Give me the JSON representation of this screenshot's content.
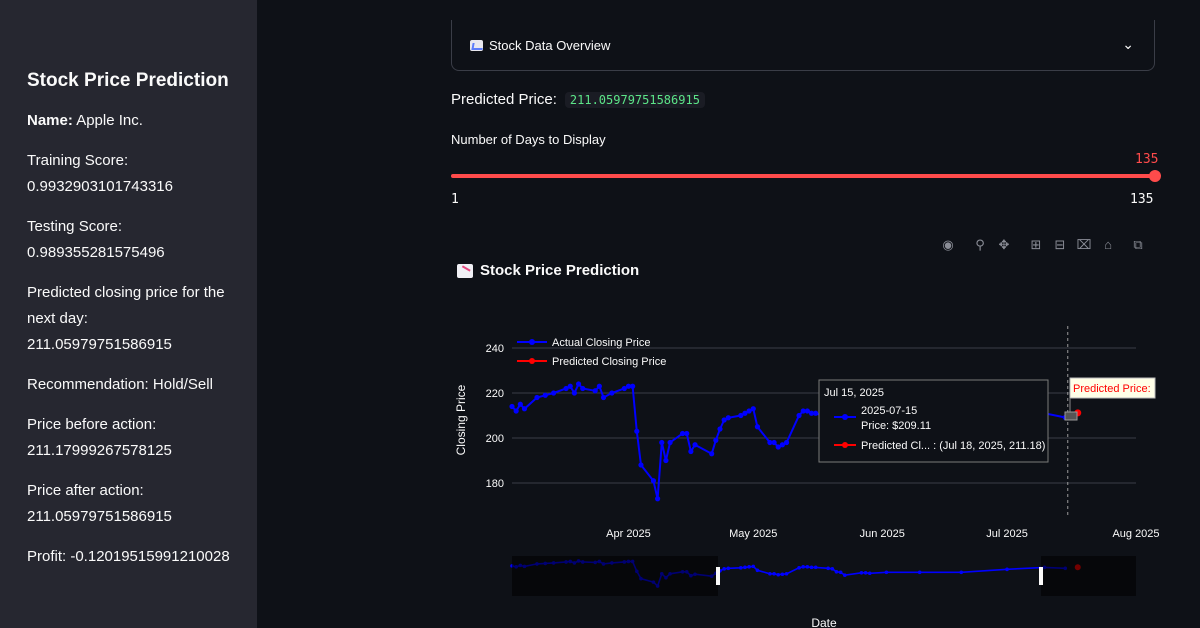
{
  "sidebar": {
    "title": "Stock Price Prediction",
    "name_label": "Name:",
    "name_value": "Apple Inc.",
    "training_label": "Training Score:",
    "training_value": "0.9932903101743316",
    "testing_label": "Testing Score:",
    "testing_value": "0.989355281575496",
    "predicted_label": "Predicted closing price for the next day:",
    "predicted_value": "211.05979751586915",
    "recommendation": "Recommendation: Hold/Sell",
    "before_label": "Price before action:",
    "before_value": "211.17999267578125",
    "after_label": "Price after action:",
    "after_value": "211.05979751586915",
    "profit": "Profit: -0.12019515991210028"
  },
  "expander": {
    "label": "Stock Data Overview"
  },
  "predicted": {
    "label": "Predicted Price:",
    "value": "211.05979751586915"
  },
  "slider": {
    "label": "Number of Days to Display",
    "value": "135",
    "min": "1",
    "max": "135",
    "fraction": 1.0
  },
  "chart_title": "Stock Price Prediction",
  "modebar_icons": [
    "camera-icon",
    "zoom-icon",
    "pan-icon",
    "zoom-in-icon",
    "zoom-out-icon",
    "autoscale-icon",
    "reset-axes-icon",
    "fullscreen-icon"
  ],
  "chart_data": {
    "type": "line",
    "ylabel": "Closing Price",
    "xlabel": "Date",
    "yticks": [
      180,
      200,
      220,
      240
    ],
    "xticks": [
      "Apr 2025",
      "May 2025",
      "Jun 2025",
      "Jul 2025",
      "Aug 2025"
    ],
    "xtick_dates": [
      "2025-04-01",
      "2025-05-01",
      "2025-06-01",
      "2025-07-01",
      "2025-08-01"
    ],
    "x_range": [
      "2025-03-04",
      "2025-08-01"
    ],
    "ylim": [
      168,
      248
    ],
    "legend_position": "top-left",
    "series": [
      {
        "name": "Actual Closing Price",
        "color": "#0000ff",
        "points": [
          [
            "2025-03-04",
            214
          ],
          [
            "2025-03-05",
            212
          ],
          [
            "2025-03-06",
            215
          ],
          [
            "2025-03-07",
            213
          ],
          [
            "2025-03-10",
            218
          ],
          [
            "2025-03-12",
            219
          ],
          [
            "2025-03-14",
            220
          ],
          [
            "2025-03-17",
            222
          ],
          [
            "2025-03-18",
            223
          ],
          [
            "2025-03-19",
            220
          ],
          [
            "2025-03-20",
            224
          ],
          [
            "2025-03-21",
            222
          ],
          [
            "2025-03-24",
            221
          ],
          [
            "2025-03-25",
            223
          ],
          [
            "2025-03-26",
            218
          ],
          [
            "2025-03-28",
            220
          ],
          [
            "2025-03-31",
            222
          ],
          [
            "2025-04-01",
            223
          ],
          [
            "2025-04-02",
            223
          ],
          [
            "2025-04-03",
            203
          ],
          [
            "2025-04-04",
            188
          ],
          [
            "2025-04-07",
            181
          ],
          [
            "2025-04-08",
            173
          ],
          [
            "2025-04-09",
            198
          ],
          [
            "2025-04-10",
            190
          ],
          [
            "2025-04-11",
            198
          ],
          [
            "2025-04-14",
            202
          ],
          [
            "2025-04-15",
            202
          ],
          [
            "2025-04-16",
            194
          ],
          [
            "2025-04-17",
            197
          ],
          [
            "2025-04-21",
            193
          ],
          [
            "2025-04-22",
            199
          ],
          [
            "2025-04-23",
            204
          ],
          [
            "2025-04-24",
            208
          ],
          [
            "2025-04-25",
            209
          ],
          [
            "2025-04-28",
            210
          ],
          [
            "2025-04-29",
            211
          ],
          [
            "2025-04-30",
            212
          ],
          [
            "2025-05-01",
            213
          ],
          [
            "2025-05-02",
            205
          ],
          [
            "2025-05-05",
            198
          ],
          [
            "2025-05-06",
            198
          ],
          [
            "2025-05-07",
            196
          ],
          [
            "2025-05-08",
            197
          ],
          [
            "2025-05-09",
            198
          ],
          [
            "2025-05-12",
            210
          ],
          [
            "2025-05-13",
            212
          ],
          [
            "2025-05-14",
            212
          ],
          [
            "2025-05-15",
            211
          ],
          [
            "2025-05-16",
            211
          ],
          [
            "2025-05-19",
            209
          ],
          [
            "2025-05-20",
            208
          ],
          [
            "2025-05-21",
            202
          ],
          [
            "2025-05-22",
            201
          ],
          [
            "2025-05-23",
            195
          ],
          [
            "2025-05-27",
            200
          ],
          [
            "2025-05-28",
            200
          ],
          [
            "2025-05-29",
            199
          ],
          [
            "2025-06-02",
            201
          ],
          [
            "2025-06-10",
            201
          ],
          [
            "2025-06-20",
            201
          ],
          [
            "2025-07-01",
            207
          ],
          [
            "2025-07-10",
            211
          ],
          [
            "2025-07-15",
            209.11
          ]
        ]
      },
      {
        "name": "Predicted Closing Price",
        "color": "#ff0000",
        "points": [
          [
            "2025-07-18",
            211.18
          ]
        ]
      }
    ],
    "hover": {
      "date": "Jul 15, 2025",
      "actual_date": "2025-07-15",
      "actual_price": "Price: $209.11",
      "predicted_text": "Predicted Cl... : (Jul 18, 2025, 211.18)"
    },
    "annotation": "Predicted Price:"
  }
}
